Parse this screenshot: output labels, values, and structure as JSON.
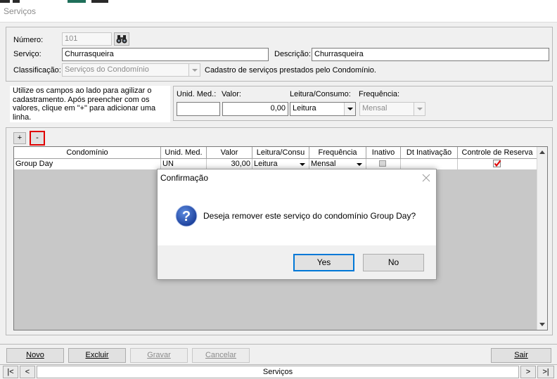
{
  "window": {
    "title": "Serviços"
  },
  "form": {
    "numero_label": "Número:",
    "numero_value": "101",
    "servico_label": "Serviço:",
    "servico_value": "Churrasqueira",
    "descricao_label": "Descrição:",
    "descricao_value": "Churrasqueira",
    "classificacao_label": "Classificação:",
    "classificacao_value": "Serviços do Condomínio",
    "classificacao_hint": "Cadastro de serviços prestados pelo Condomínio."
  },
  "helper": {
    "text": "Utilize os campos ao lado para agilizar o cadastramento. Após preencher com os valores, clique em \"+\" para adicionar uma linha.",
    "unid_label": "Unid. Med.:",
    "valor_label": "Valor:",
    "valor_value": "0,00",
    "leitura_label": "Leitura/Consumo:",
    "leitura_value": "Leitura",
    "frequencia_label": "Frequência:",
    "frequencia_value": "Mensal"
  },
  "grid": {
    "add_label": "+",
    "remove_label": "-",
    "columns": [
      "Condomínio",
      "Unid. Med.",
      "Valor",
      "Leitura/Consu",
      "Frequência",
      "Inativo",
      "Dt Inativação",
      "Controle de Reserva"
    ],
    "rows": [
      {
        "condominio": "Group Day",
        "unid": "UN",
        "valor": "30,00",
        "leitura": "Leitura",
        "frequencia": "Mensal",
        "inativo": false,
        "dt_inativacao": "",
        "controle_reserva": true
      }
    ]
  },
  "dialog": {
    "title": "Confirmação",
    "message": "Deseja remover este serviço do condomínio Group Day?",
    "yes_label": "Yes",
    "no_label": "No",
    "icon": "question-icon"
  },
  "toolbar": {
    "novo_label": "Novo",
    "excluir_label": "Excluir",
    "gravar_label": "Gravar",
    "cancelar_label": "Cancelar",
    "sair_label": "Sair"
  },
  "navigator": {
    "first_label": "|<",
    "prev_label": "<",
    "caption": "Serviços",
    "next_label": ">",
    "last_label": ">|"
  },
  "colors": {
    "accent": "#0078d7",
    "highlight_border": "#e00000",
    "grid_empty": "#c8c8c8"
  }
}
